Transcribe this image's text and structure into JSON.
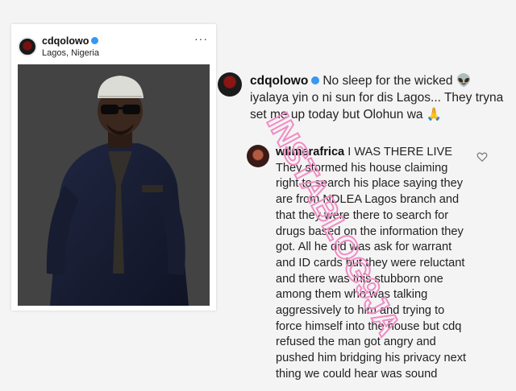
{
  "post": {
    "username": "cdqolowo",
    "location": "Lagos, Nigeria",
    "more_label": "···"
  },
  "caption": {
    "username": "cdqolowo",
    "text": "No sleep for the wicked 👽 iyalaya yin o ni sun for dis Lagos... They tryna set me up today but Olohun wa 🙏"
  },
  "reply": {
    "username": "wilmerafrica",
    "text": "I WAS THERE LIVE They stormed his house claiming right to search his place saying they are from NDLEA Lagos branch and that they were there to search for drugs based on the information they got. All he did was ask for warrant and  ID cards but they were reluctant and there was this stubborn one among them who was talking aggressively to him and trying to force himself into the house but cdq refused the man got angry and pushed him bridging his privacy next thing we could hear was sound"
  },
  "watermark": {
    "text": "INSTABLOG9JA",
    "color": "#f08cc4"
  },
  "colors": {
    "verified": "#3897f0",
    "background": "#f4f4f4"
  }
}
